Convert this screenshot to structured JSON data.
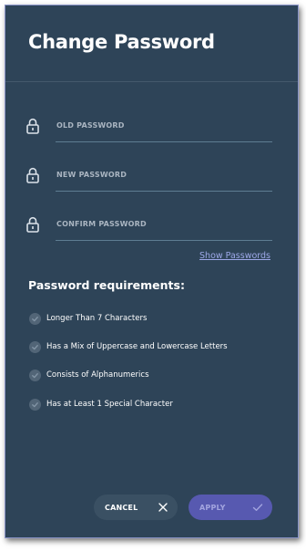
{
  "dialog": {
    "title": "Change Password"
  },
  "fields": [
    {
      "label": "OLD PASSWORD",
      "value": ""
    },
    {
      "label": "NEW PASSWORD",
      "value": ""
    },
    {
      "label": "CONFIRM PASSWORD",
      "value": ""
    }
  ],
  "show_passwords_label": "Show Passwords",
  "requirements": {
    "title": "Password requirements:",
    "items": [
      "Longer Than 7 Characters",
      "Has a Mix of Uppercase and Lowercase Letters",
      "Consists of Alphanumerics",
      "Has at Least 1 Special Character"
    ]
  },
  "buttons": {
    "cancel_label": "CANCEL",
    "apply_label": "APPLY"
  },
  "icons": {
    "field_icon": "lock-icon",
    "requirement_icon": "check-circle-icon",
    "cancel_icon": "close-icon",
    "apply_icon": "checkmark-icon"
  },
  "colors": {
    "panel_background": "#2e4458",
    "accent": "#5759b0",
    "link": "#9da8e8"
  }
}
